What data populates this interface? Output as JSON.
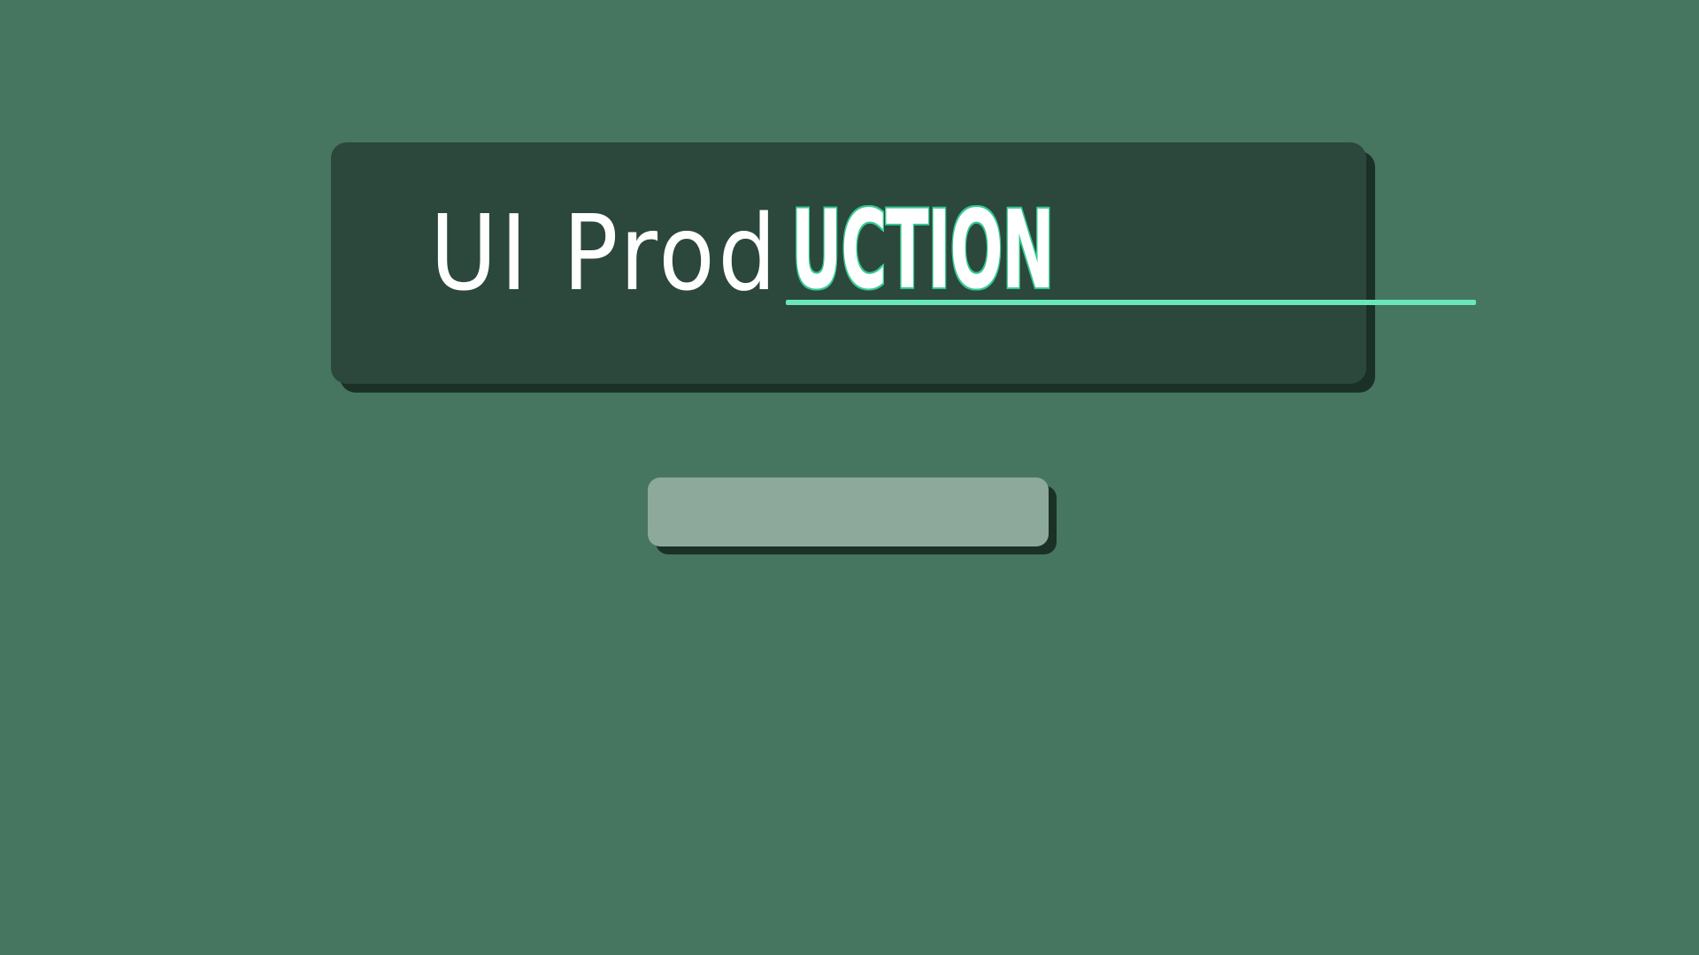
{
  "title": {
    "light": "UI Prod",
    "bold": "UCTION"
  },
  "progress": {
    "value": 0
  },
  "colors": {
    "background": "#46765f",
    "panel": "#2c473b",
    "shadow": "#1b3127",
    "accent": "#47dfa8",
    "track": "#8ca99b"
  }
}
